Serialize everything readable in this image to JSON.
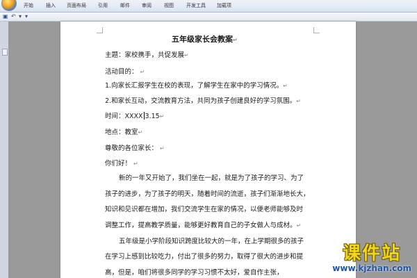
{
  "ribbon": {
    "tabs": [
      "开始",
      "插入",
      "页面布局",
      "引用",
      "邮件",
      "审阅",
      "视图",
      "开发工具",
      "加载项"
    ]
  },
  "quick_access": {
    "save_icon": "save-icon",
    "undo_icon": "undo-icon",
    "redo_icon": "redo-icon"
  },
  "document": {
    "title": "五年级家长会教案",
    "lines": [
      "主题：家校携手，共促发展",
      "活动目的：",
      "1.向家长汇报学生在校的表现，了解学生在家中的学习情况。",
      "2.和家长互动，交流教育方法，共同为孩子创建良好的学习氛围。",
      "时间：XXXX",
      "地点：教室",
      "尊敬的各位家长：",
      "你们好！",
      "新的一年又开始了，我们坐在一起，就是为了孩子的学习、为了",
      "孩子的进步，为了孩子的明天，随着时间的流逝，孩子们渐渐地长大，",
      "知识和见识都在增加，我们交流学生在家的情况，以便老师能够及时",
      "调整工作，提高教学质量，能够更好教育自己的子女做人与成材。",
      "五年级是小学阶段知识跨度比较大的一年，在上学期很多的孩子",
      "在学习上感到比较吃力，付出了很多的努力，取得了很大的进步和提",
      "高，但是，咱们将很多同学的学习习惯不太好，爱自作主张，"
    ],
    "time_suffix": "3.15",
    "paragraph_mark": "↵"
  },
  "watermark": {
    "brand": "课件站",
    "url": "www.kjzhan.com"
  }
}
